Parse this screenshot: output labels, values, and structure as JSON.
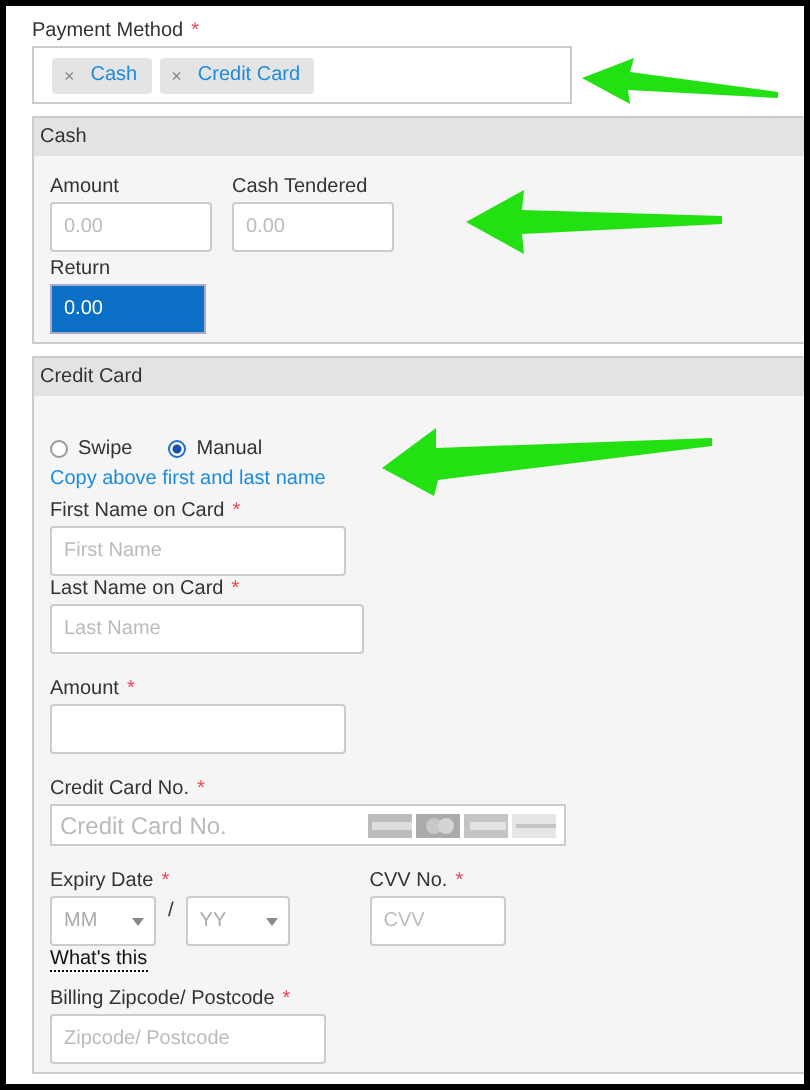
{
  "payment_method": {
    "label": "Payment Method",
    "required_mark": "*",
    "tags": [
      {
        "remove": "×",
        "label": "Cash"
      },
      {
        "remove": "×",
        "label": "Credit Card"
      }
    ]
  },
  "cash": {
    "title": "Cash",
    "fields": [
      {
        "label": "Amount",
        "placeholder": "0.00"
      },
      {
        "label": "Cash Tendered",
        "placeholder": "0.00"
      }
    ],
    "return": {
      "label": "Return",
      "value": "0.00"
    }
  },
  "credit_card": {
    "title": "Credit Card",
    "modes": [
      {
        "label": "Swipe",
        "selected": false
      },
      {
        "label": "Manual",
        "selected": true
      }
    ],
    "copy_link": "Copy above first and last name",
    "name_fields": [
      {
        "label": "First Name on Card",
        "required_mark": "*",
        "placeholder": "First Name"
      },
      {
        "label": "Last Name on Card",
        "required_mark": "*",
        "placeholder": "Last Name"
      }
    ],
    "amount": {
      "label": "Amount",
      "required_mark": "*"
    },
    "card_number": {
      "label": "Credit Card No.",
      "required_mark": "*",
      "placeholder": "Credit Card No."
    },
    "expiry": {
      "label": "Expiry Date",
      "required_mark": "*",
      "month": "MM",
      "separator": "/",
      "year": "YY"
    },
    "cvv": {
      "label": "CVV No.",
      "required_mark": "*",
      "placeholder": "CVV"
    },
    "help_link": "What's this",
    "zipcode": {
      "label": "Billing Zipcode/ Postcode",
      "required_mark": "*",
      "placeholder": "Zipcode/ Postcode"
    }
  }
}
